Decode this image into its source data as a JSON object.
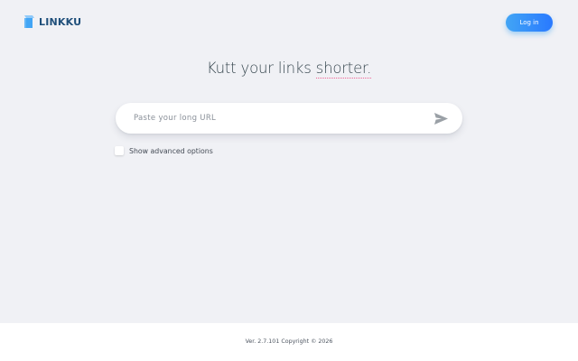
{
  "header": {
    "logo_text": "LINKKU",
    "login_label": "Log in"
  },
  "main": {
    "title_prefix": "Kutt your links ",
    "title_highlight": "shorter.",
    "search_placeholder": "Paste your long URL",
    "advanced_label": "Show advanced options"
  },
  "footer": {
    "text": "Ver. 2.7.101 Copyright © 2026"
  },
  "colors": {
    "background": "#f0f1f5",
    "accent": "#2979ff",
    "accent_light": "#42a5f5",
    "title_underline": "#f06292",
    "logo_text": "#1f4f7a"
  },
  "icons": {
    "logo": "link-logo-icon",
    "send": "send-icon"
  }
}
